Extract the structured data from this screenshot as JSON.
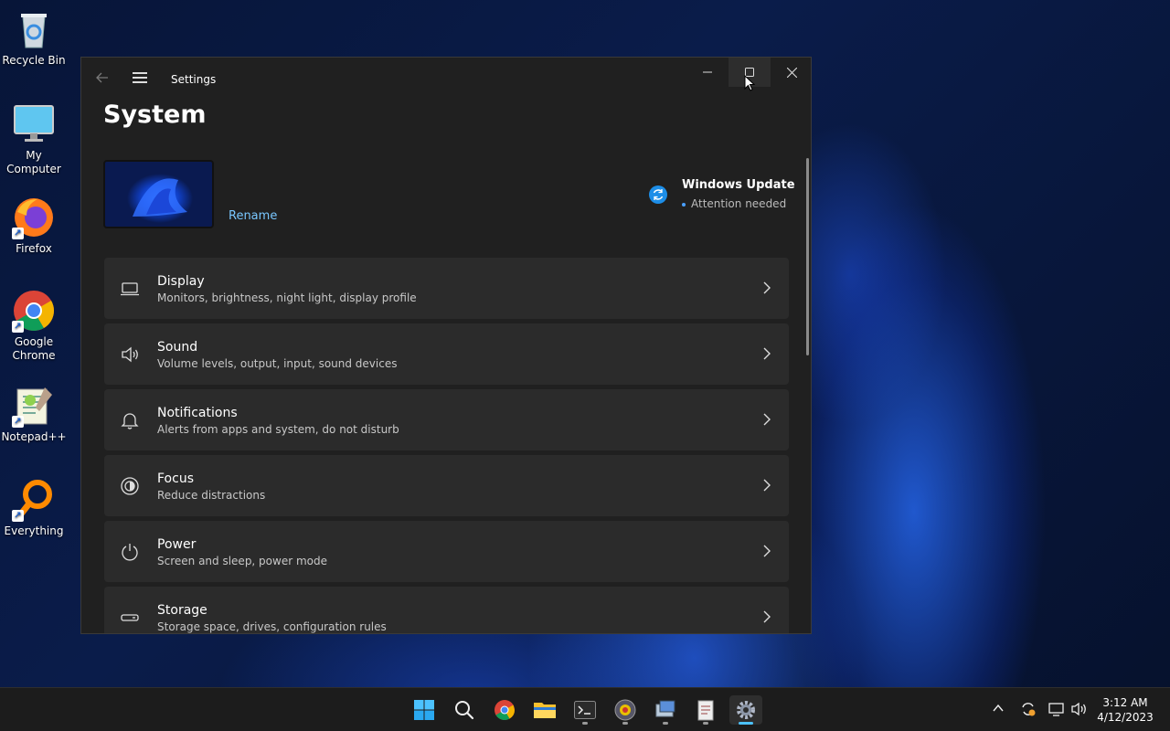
{
  "desktop": {
    "icons": [
      {
        "label": "Recycle Bin",
        "icon": "recycle-bin-icon"
      },
      {
        "label": "My Computer",
        "icon": "computer-icon"
      },
      {
        "label": "Firefox",
        "icon": "firefox-icon"
      },
      {
        "label": "Google Chrome",
        "icon": "chrome-icon"
      },
      {
        "label": "Notepad++",
        "icon": "notepadpp-icon"
      },
      {
        "label": "Everything",
        "icon": "everything-icon"
      }
    ]
  },
  "window": {
    "title": "Settings",
    "back_icon": "back-arrow-icon",
    "menu_icon": "hamburger-menu-icon",
    "controls": {
      "minimize": "—",
      "maximize": "☐",
      "close": "✕"
    }
  },
  "page": {
    "title": "System",
    "device": {
      "rename_label": "Rename"
    },
    "windows_update": {
      "title": "Windows Update",
      "status": "Attention needed",
      "accent": "#1d8ee8"
    },
    "items": [
      {
        "title": "Display",
        "subtitle": "Monitors, brightness, night light, display profile",
        "icon": "display-icon"
      },
      {
        "title": "Sound",
        "subtitle": "Volume levels, output, input, sound devices",
        "icon": "speaker-icon"
      },
      {
        "title": "Notifications",
        "subtitle": "Alerts from apps and system, do not disturb",
        "icon": "bell-icon"
      },
      {
        "title": "Focus",
        "subtitle": "Reduce distractions",
        "icon": "focus-icon"
      },
      {
        "title": "Power",
        "subtitle": "Screen and sleep, power mode",
        "icon": "power-icon"
      },
      {
        "title": "Storage",
        "subtitle": "Storage space, drives, configuration rules",
        "icon": "storage-icon"
      }
    ]
  },
  "taskbar": {
    "apps": [
      "start-icon",
      "search-icon",
      "chrome-icon",
      "file-explorer-icon",
      "terminal-icon",
      "app-icon",
      "remote-desktop-icon",
      "notepad-icon",
      "settings-icon"
    ],
    "clock": {
      "time": "3:12 AM",
      "date": "4/12/2023"
    }
  }
}
